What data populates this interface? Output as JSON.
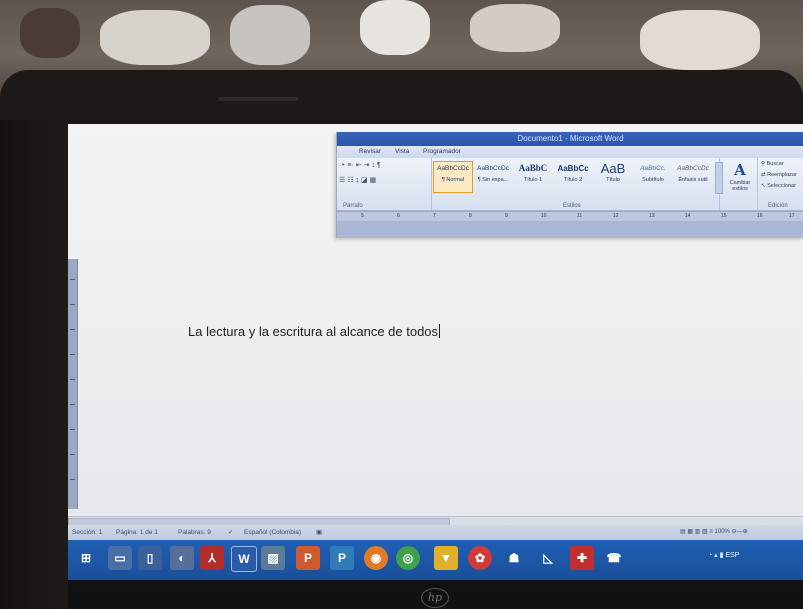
{
  "word": {
    "title": "Documento1 - Microsoft Word",
    "tabs": [
      "Revisar",
      "Vista",
      "Programador"
    ],
    "paragraph_group_label": "Párrafo",
    "styles_group_label": "Estilos",
    "editing_group_label": "Edición",
    "styles": [
      {
        "sample": "AaBbCcDc",
        "name": "¶ Normal",
        "selected": true
      },
      {
        "sample": "AaBbCcDc",
        "name": "¶ Sin espa..."
      },
      {
        "sample": "AaBbC",
        "name": "Título 1"
      },
      {
        "sample": "AaBbCc",
        "name": "Título 2"
      },
      {
        "sample": "AaB",
        "name": "Título"
      },
      {
        "sample": "AaBbCc.",
        "name": "Subtítulo"
      },
      {
        "sample": "AaBbCcDc",
        "name": "Énfasis sutil"
      }
    ],
    "change_styles": {
      "label_line1": "Cambiar",
      "label_line2": "estilos"
    },
    "editing": {
      "find": "Buscar",
      "replace": "Reemplazar",
      "select": "Seleccionar"
    },
    "ruler_numbers": [
      "5",
      "6",
      "7",
      "8",
      "9",
      "10",
      "11",
      "12",
      "13",
      "14",
      "15",
      "16",
      "17"
    ]
  },
  "document": {
    "text": "La lectura y la escritura al alcance de todos"
  },
  "statusbar": {
    "section": "Sección: 1",
    "page": "Página: 1 de 1",
    "words": "Palabras: 9",
    "language": "Español (Colombia)",
    "zoom": "100%"
  },
  "taskbar": {
    "tray_language": "ESP"
  }
}
